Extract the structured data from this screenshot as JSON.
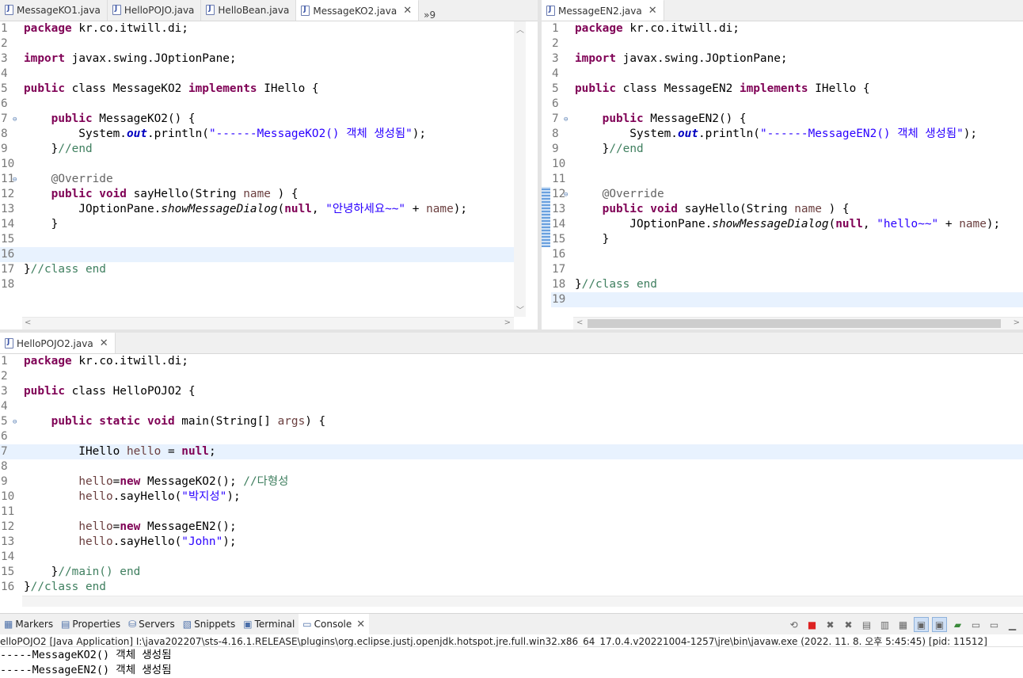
{
  "left_tabs": [
    {
      "label": "MessageKO1.java",
      "active": false
    },
    {
      "label": "HelloPOJO.java",
      "active": false
    },
    {
      "label": "HelloBean.java",
      "active": false
    },
    {
      "label": "MessageKO2.java",
      "active": true
    }
  ],
  "left_overflow": "»9",
  "right_tabs": [
    {
      "label": "MessageEN2.java",
      "active": true
    }
  ],
  "bottom_tabs": [
    {
      "label": "HelloPOJO2.java",
      "active": true
    }
  ],
  "close_glyph": "✕",
  "left_code": [
    {
      "n": "1",
      "t": [
        [
          "kw",
          "package"
        ],
        [
          "",
          "kr.co.itwill.di;"
        ]
      ]
    },
    {
      "n": "2",
      "t": []
    },
    {
      "n": "3",
      "t": [
        [
          "kw",
          "import"
        ],
        [
          "",
          "javax.swing.JOptionPane;"
        ]
      ]
    },
    {
      "n": "4",
      "t": []
    },
    {
      "n": "5",
      "t": [
        [
          "kw",
          "public"
        ],
        [
          "",
          "class MessageKO2 "
        ],
        [
          "kw",
          "implements"
        ],
        [
          "",
          " IHello {"
        ]
      ]
    },
    {
      "n": "6",
      "t": []
    },
    {
      "n": "7",
      "fold": true,
      "t": [
        [
          "",
          "    "
        ],
        [
          "kw",
          "public"
        ],
        [
          "",
          "",
          " MessageKO2() {"
        ]
      ]
    },
    {
      "n": "8",
      "t": [
        [
          "",
          "        System."
        ],
        [
          "fld",
          "out"
        ],
        [
          "",
          ".println("
        ],
        [
          "str",
          "\"------MessageKO2() 객체 생성됨\""
        ],
        [
          "",
          ");"
        ]
      ]
    },
    {
      "n": "9",
      "t": [
        [
          "",
          "    }"
        ],
        [
          "cm",
          "//end"
        ]
      ]
    },
    {
      "n": "10",
      "t": []
    },
    {
      "n": "11",
      "fold": true,
      "t": [
        [
          "ann",
          "    @Override"
        ]
      ]
    },
    {
      "n": "12",
      "t": [
        [
          "",
          "    "
        ],
        [
          "kw",
          "public void"
        ],
        [
          "",
          " sayHello(String "
        ],
        [
          "var",
          "name"
        ],
        [
          "",
          " ) {"
        ]
      ]
    },
    {
      "n": "13",
      "t": [
        [
          "",
          "        JOptionPane."
        ],
        [
          "it",
          "showMessageDialog"
        ],
        [
          "",
          "("
        ],
        [
          "kw",
          "null"
        ],
        [
          "",
          ", "
        ],
        [
          "str",
          "\"안녕하세요~~\""
        ],
        [
          "",
          " + "
        ],
        [
          "var",
          "name"
        ],
        [
          "",
          ");"
        ]
      ]
    },
    {
      "n": "14",
      "t": [
        [
          "",
          "    }"
        ]
      ]
    },
    {
      "n": "15",
      "t": []
    },
    {
      "n": "16",
      "hl": true,
      "t": []
    },
    {
      "n": "17",
      "t": [
        [
          "",
          "}"
        ],
        [
          "cm",
          "//class end"
        ]
      ]
    },
    {
      "n": "18",
      "t": []
    }
  ],
  "right_code": [
    {
      "n": "1",
      "t": [
        [
          "kw",
          "package"
        ],
        [
          "",
          "kr.co.itwill.di;"
        ]
      ]
    },
    {
      "n": "2",
      "t": []
    },
    {
      "n": "3",
      "t": [
        [
          "kw",
          "import"
        ],
        [
          "",
          "javax.swing.JOptionPane;"
        ]
      ]
    },
    {
      "n": "4",
      "t": []
    },
    {
      "n": "5",
      "t": [
        [
          "kw",
          "public"
        ],
        [
          "",
          "class MessageEN2 "
        ],
        [
          "kw",
          "implements"
        ],
        [
          "",
          " IHello {"
        ]
      ]
    },
    {
      "n": "6",
      "t": []
    },
    {
      "n": "7",
      "fold": true,
      "t": [
        [
          "",
          "    "
        ],
        [
          "kw",
          "public"
        ],
        [
          "",
          "",
          " MessageEN2() {"
        ]
      ]
    },
    {
      "n": "8",
      "t": [
        [
          "",
          "        System."
        ],
        [
          "fld",
          "out"
        ],
        [
          "",
          ".println("
        ],
        [
          "str",
          "\"------MessageEN2() 객체 생성됨\""
        ],
        [
          "",
          ");"
        ]
      ]
    },
    {
      "n": "9",
      "t": [
        [
          "",
          "    }"
        ],
        [
          "cm",
          "//end"
        ]
      ]
    },
    {
      "n": "10",
      "t": []
    },
    {
      "n": "11",
      "t": []
    },
    {
      "n": "12",
      "fold": true,
      "t": [
        [
          "ann",
          "    @Override"
        ]
      ]
    },
    {
      "n": "13",
      "t": [
        [
          "",
          "    "
        ],
        [
          "kw",
          "public void"
        ],
        [
          "",
          " sayHello(String "
        ],
        [
          "var",
          "name"
        ],
        [
          "",
          " ) {"
        ]
      ]
    },
    {
      "n": "14",
      "t": [
        [
          "",
          "        JOptionPane."
        ],
        [
          "it",
          "showMessageDialog"
        ],
        [
          "",
          "("
        ],
        [
          "kw",
          "null"
        ],
        [
          "",
          ", "
        ],
        [
          "str",
          "\"hello~~\""
        ],
        [
          "",
          " + "
        ],
        [
          "var",
          "name"
        ],
        [
          "",
          ");"
        ]
      ]
    },
    {
      "n": "15",
      "t": [
        [
          "",
          "    }"
        ]
      ]
    },
    {
      "n": "16",
      "t": []
    },
    {
      "n": "17",
      "t": []
    },
    {
      "n": "18",
      "t": [
        [
          "",
          "}"
        ],
        [
          "cm",
          "//class end"
        ]
      ]
    },
    {
      "n": "19",
      "hl": true,
      "t": []
    }
  ],
  "bottom_code": [
    {
      "n": "1",
      "t": [
        [
          "kw",
          "package"
        ],
        [
          "",
          "kr.co.itwill.di;"
        ]
      ]
    },
    {
      "n": "2",
      "t": []
    },
    {
      "n": "3",
      "t": [
        [
          "kw",
          "public"
        ],
        [
          "",
          "class HelloPOJO2 {"
        ]
      ]
    },
    {
      "n": "4",
      "t": []
    },
    {
      "n": "5",
      "fold": true,
      "t": [
        [
          "",
          "    "
        ],
        [
          "kw",
          "public static void"
        ],
        [
          "",
          " main(String[] "
        ],
        [
          "var",
          "args"
        ],
        [
          "",
          ") {"
        ]
      ]
    },
    {
      "n": "6",
      "t": []
    },
    {
      "n": "7",
      "hl": true,
      "t": [
        [
          "",
          "        IHello "
        ],
        [
          "var",
          "hello"
        ],
        [
          "",
          " = "
        ],
        [
          "kw",
          "null"
        ],
        [
          "",
          ";"
        ]
      ]
    },
    {
      "n": "8",
      "t": []
    },
    {
      "n": "9",
      "t": [
        [
          "",
          "        "
        ],
        [
          "var",
          "hello"
        ],
        [
          "",
          "="
        ],
        [
          "kw",
          "new"
        ],
        [
          "",
          " MessageKO2(); "
        ],
        [
          "cm",
          "//다형성"
        ]
      ]
    },
    {
      "n": "10",
      "t": [
        [
          "",
          "        "
        ],
        [
          "var",
          "hello"
        ],
        [
          "",
          ".sayHello("
        ],
        [
          "str",
          "\"박지성\""
        ],
        [
          "",
          ");"
        ]
      ]
    },
    {
      "n": "11",
      "t": []
    },
    {
      "n": "12",
      "t": [
        [
          "",
          "        "
        ],
        [
          "var",
          "hello"
        ],
        [
          "",
          "="
        ],
        [
          "kw",
          "new"
        ],
        [
          "",
          " MessageEN2();"
        ]
      ]
    },
    {
      "n": "13",
      "t": [
        [
          "",
          "        "
        ],
        [
          "var",
          "hello"
        ],
        [
          "",
          ".sayHello("
        ],
        [
          "str",
          "\"John\""
        ],
        [
          "",
          ");"
        ]
      ]
    },
    {
      "n": "14",
      "t": []
    },
    {
      "n": "15",
      "t": [
        [
          "",
          "    }"
        ],
        [
          "cm",
          "//main() end"
        ]
      ]
    },
    {
      "n": "16",
      "t": [
        [
          "",
          "}"
        ],
        [
          "cm",
          "//class end"
        ]
      ]
    }
  ],
  "views": [
    {
      "label": "Markers",
      "icon": "markers-icon",
      "glyph": "▦"
    },
    {
      "label": "Properties",
      "icon": "properties-icon",
      "glyph": "▤"
    },
    {
      "label": "Servers",
      "icon": "servers-icon",
      "glyph": "⛁"
    },
    {
      "label": "Snippets",
      "icon": "snippets-icon",
      "glyph": "▧"
    },
    {
      "label": "Terminal",
      "icon": "terminal-icon",
      "glyph": "▣"
    },
    {
      "label": "Console",
      "icon": "console-icon",
      "glyph": "▭",
      "active": true
    }
  ],
  "console": {
    "header": "elloPOJO2 [Java Application] I:\\java202207\\sts-4.16.1.RELEASE\\plugins\\org.eclipse.justj.openjdk.hotspot.jre.full.win32.x86_64_17.0.4.v20221004-1257\\jre\\bin\\javaw.exe  (2022. 11. 8. 오후 5:45:45) [pid: 11512]",
    "lines": [
      "-----MessageKO2() 객체 생성됨",
      "-----MessageEN2() 객체 생성됨"
    ]
  }
}
